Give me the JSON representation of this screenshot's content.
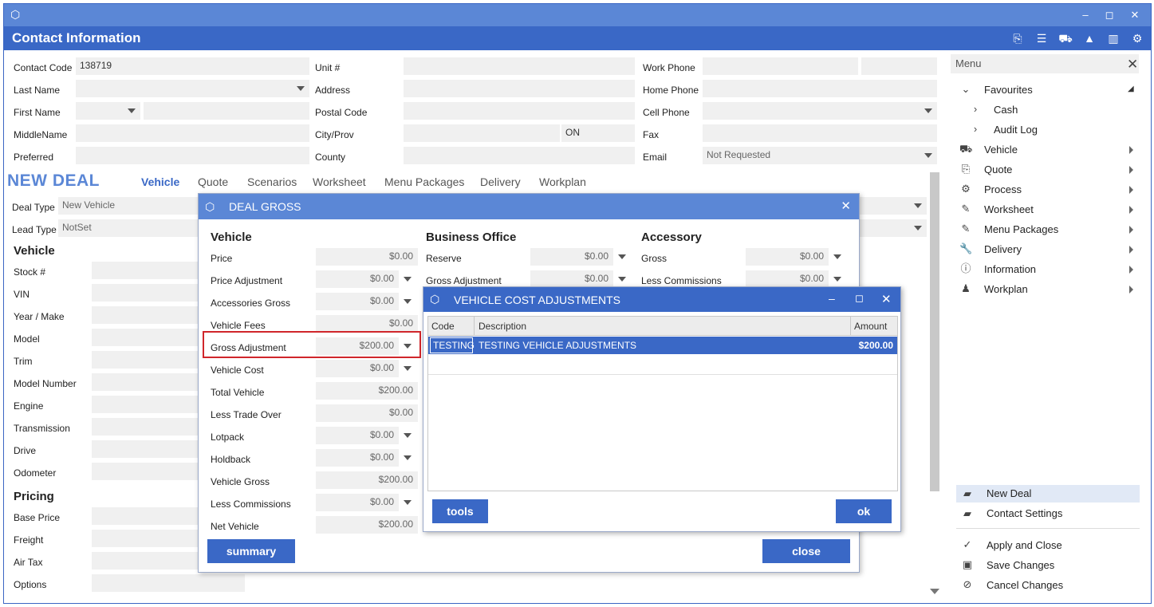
{
  "window": {
    "title": "Contact Information",
    "controls": {
      "minimize": "‒",
      "maximize": "◻",
      "close": "✕"
    }
  },
  "contact": {
    "contact_code": {
      "label": "Contact Code",
      "value": "138719"
    },
    "last_name": {
      "label": "Last Name",
      "value": ""
    },
    "first_name": {
      "label": "First Name",
      "value": ""
    },
    "middle_name": {
      "label": "MiddleName",
      "value": ""
    },
    "preferred": {
      "label": "Preferred",
      "value": ""
    },
    "unit": {
      "label": "Unit #",
      "value": ""
    },
    "address": {
      "label": "Address",
      "value": ""
    },
    "postal_code": {
      "label": "Postal Code",
      "value": ""
    },
    "city_prov": {
      "label": "City/Prov",
      "value": "",
      "prov": "ON"
    },
    "county": {
      "label": "County",
      "value": ""
    },
    "work_phone": {
      "label": "Work Phone",
      "value": ""
    },
    "home_phone": {
      "label": "Home Phone",
      "value": ""
    },
    "cell_phone": {
      "label": "Cell Phone",
      "value": ""
    },
    "fax": {
      "label": "Fax",
      "value": ""
    },
    "email": {
      "label": "Email",
      "value": "Not Requested"
    }
  },
  "deal": {
    "heading": "NEW DEAL",
    "tabs": [
      "Vehicle",
      "Quote",
      "Scenarios",
      "Worksheet",
      "Menu Packages",
      "Delivery",
      "Workplan"
    ],
    "deal_type": {
      "label": "Deal Type",
      "value": "New Vehicle"
    },
    "lead_type": {
      "label": "Lead Type",
      "value": "NotSet"
    },
    "vehicle_section": "Vehicle",
    "vehicle_fields": [
      "Stock #",
      "VIN",
      "Year / Make",
      "Model",
      "Trim",
      "Model Number",
      "Engine",
      "Transmission",
      "Drive",
      "Odometer"
    ],
    "pricing_section": "Pricing",
    "pricing_fields": [
      "Base Price",
      "Freight",
      "Air Tax",
      "Options"
    ]
  },
  "menu": {
    "search_placeholder": "Menu",
    "favourites": "Favourites",
    "fav_items": [
      "Cash",
      "Audit Log"
    ],
    "items": [
      {
        "label": "Vehicle",
        "icon": "car-icon"
      },
      {
        "label": "Quote",
        "icon": "quote-icon"
      },
      {
        "label": "Process",
        "icon": "process-icon"
      },
      {
        "label": "Worksheet",
        "icon": "pencil-icon"
      },
      {
        "label": "Menu Packages",
        "icon": "pencil-icon"
      },
      {
        "label": "Delivery",
        "icon": "wrench-icon"
      },
      {
        "label": "Information",
        "icon": "info-icon"
      },
      {
        "label": "Workplan",
        "icon": "workplan-icon"
      }
    ],
    "new_deal": "New Deal",
    "contact_settings": "Contact Settings",
    "apply_close": "Apply and Close",
    "save_changes": "Save Changes",
    "cancel_changes": "Cancel Changes"
  },
  "deal_gross": {
    "title": "DEAL GROSS",
    "vehicle": {
      "heading": "Vehicle",
      "rows": [
        {
          "label": "Price",
          "value": "$0.00",
          "dropdown": false
        },
        {
          "label": "Price Adjustment",
          "value": "$0.00",
          "dropdown": true
        },
        {
          "label": "Accessories Gross",
          "value": "$0.00",
          "dropdown": true
        },
        {
          "label": "Vehicle Fees",
          "value": "$0.00",
          "dropdown": false
        },
        {
          "label": "Gross Adjustment",
          "value": "$200.00",
          "dropdown": true
        },
        {
          "label": "Vehicle Cost",
          "value": "$0.00",
          "dropdown": true
        },
        {
          "label": "Total Vehicle",
          "value": "$200.00",
          "dropdown": false
        },
        {
          "label": "Less Trade Over",
          "value": "$0.00",
          "dropdown": false
        },
        {
          "label": "Lotpack",
          "value": "$0.00",
          "dropdown": true
        },
        {
          "label": "Holdback",
          "value": "$0.00",
          "dropdown": true
        },
        {
          "label": "Vehicle Gross",
          "value": "$200.00",
          "dropdown": false
        },
        {
          "label": "Less Commissions",
          "value": "$0.00",
          "dropdown": true
        },
        {
          "label": "Net Vehicle",
          "value": "$200.00",
          "dropdown": false
        }
      ]
    },
    "business_office": {
      "heading": "Business Office",
      "rows": [
        {
          "label": "Reserve",
          "value": "$0.00"
        },
        {
          "label": "Gross Adjustment",
          "value": "$0.00"
        }
      ]
    },
    "accessory": {
      "heading": "Accessory",
      "rows": [
        {
          "label": "Gross",
          "value": "$0.00"
        },
        {
          "label": "Less Commissions",
          "value": "$0.00"
        }
      ]
    },
    "summary_button": "summary",
    "close_button": "close"
  },
  "vca": {
    "title": "VEHICLE COST ADJUSTMENTS",
    "columns": [
      "Code",
      "Description",
      "Amount"
    ],
    "rows": [
      {
        "code": "TESTING",
        "description": "TESTING VEHICLE ADJUSTMENTS",
        "amount": "$200.00"
      }
    ],
    "tools_button": "tools",
    "ok_button": "ok"
  }
}
